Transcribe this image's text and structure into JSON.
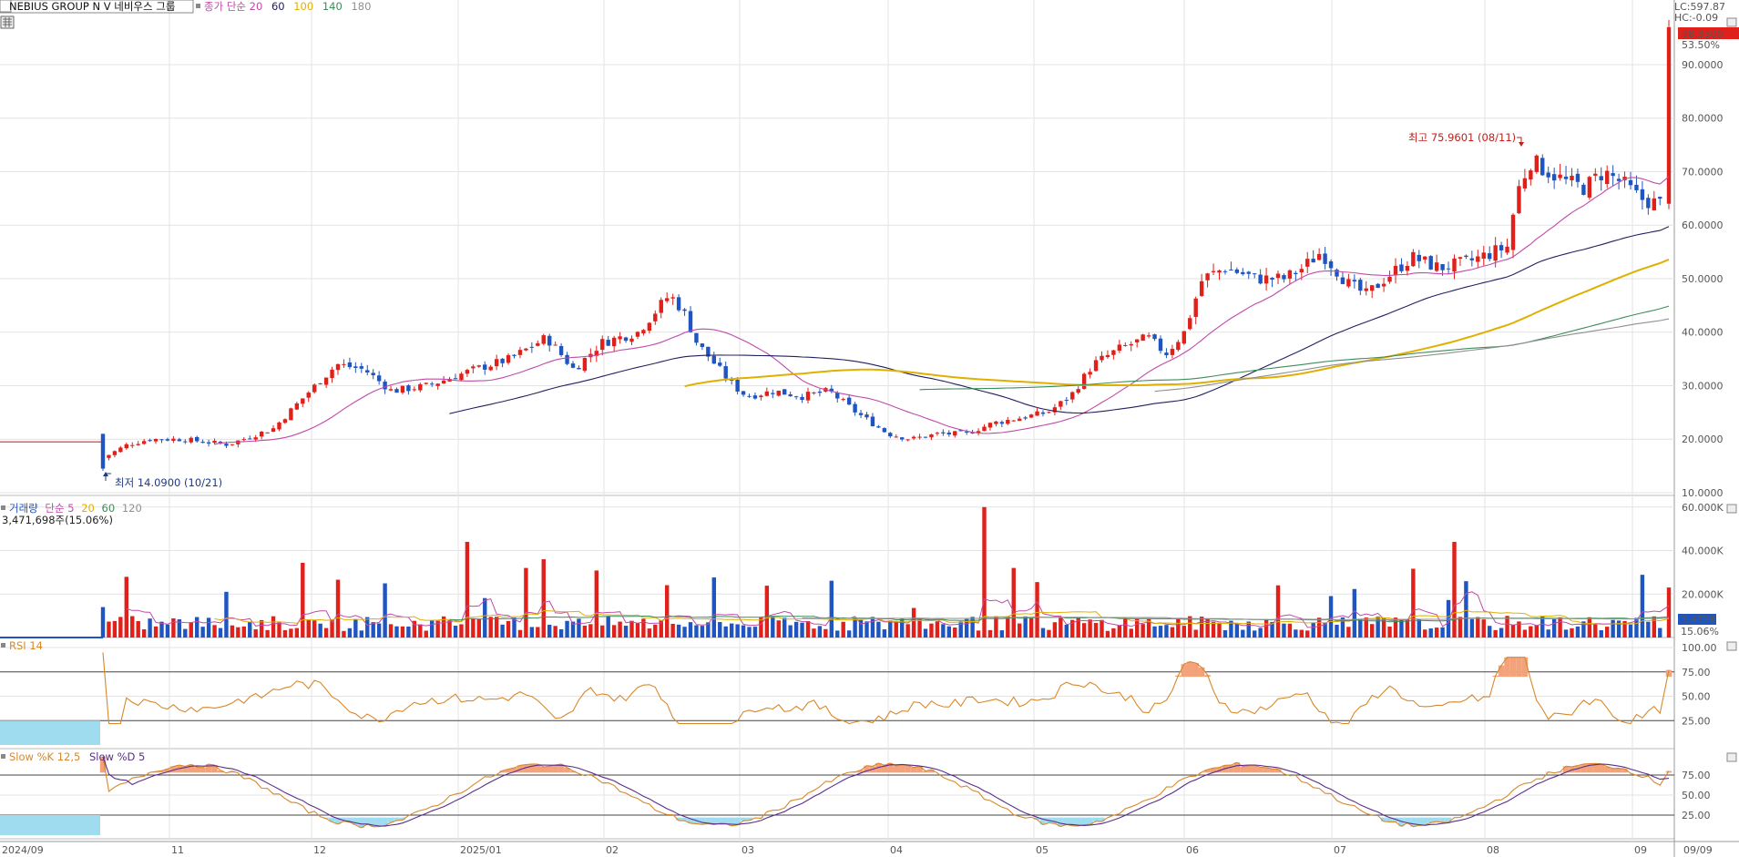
{
  "header": {
    "symbol": "NEBIUS GROUP N V",
    "name_kr": "네비우스 그룹",
    "ma_label": "종가 단순",
    "ma_periods": [
      "20",
      "60",
      "100",
      "140",
      "180"
    ],
    "lc_label": "LC:597.87",
    "hc_label": "HC:-0.09",
    "last_price": "98.3300",
    "last_change": "53.50%"
  },
  "annotations": {
    "high": "최고 75.9601 (08/11)",
    "low": "최저 14.0900 (10/21)"
  },
  "price_axis": [
    "90.0000",
    "80.0000",
    "70.0000",
    "60.0000",
    "50.0000",
    "40.0000",
    "30.0000",
    "20.0000",
    "10.0000"
  ],
  "volume": {
    "title": "거래량",
    "ma_label": "단순",
    "ma_periods": [
      "5",
      "20",
      "60",
      "120"
    ],
    "info": "3,471,698주(15.06%)",
    "axis": [
      "60.000K",
      "40.000K",
      "20.000K"
    ],
    "last_label": "3,472K",
    "last_pct": "15.06%"
  },
  "rsi": {
    "title": "RSI 14",
    "axis": [
      "100.00",
      "75.00",
      "50.00",
      "25.00"
    ]
  },
  "stoch": {
    "title_k": "Slow %K 12,5",
    "title_d": "Slow %D 5",
    "axis": [
      "75.00",
      "50.00",
      "25.00"
    ]
  },
  "x_axis": [
    "2024/09",
    "11",
    "12",
    "2025/01",
    "02",
    "03",
    "04",
    "05",
    "06",
    "07",
    "08",
    "09",
    "09/09"
  ],
  "colors": {
    "up": "#e0201a",
    "down": "#1f55c0",
    "ma20": "#c04aa8",
    "ma60": "#202060",
    "ma100": "#e0b000",
    "ma140": "#3d8c5a",
    "ma180": "#909090",
    "rsi": "#d8882a",
    "stoch_k": "#d8882a",
    "stoch_d": "#5a2d8c",
    "fill_hi": "#f3a27a",
    "fill_lo": "#9fdcf0"
  },
  "chart_data": {
    "type": "candlestick",
    "period": "daily",
    "x_range": [
      "2024/09",
      "09/09"
    ],
    "price_range": [
      10,
      98.33
    ],
    "price_anchors": [
      {
        "month": "2024/10 (10/21)",
        "price": 14.09,
        "note": "low"
      },
      {
        "month": "11",
        "price": 20
      },
      {
        "month": "12",
        "price": 34
      },
      {
        "month": "2025/01",
        "price": 31
      },
      {
        "month": "02",
        "price": 42
      },
      {
        "month": "03",
        "price": 32
      },
      {
        "month": "04",
        "price": 21
      },
      {
        "month": "05",
        "price": 30
      },
      {
        "month": "06",
        "price": 50
      },
      {
        "month": "07",
        "price": 48
      },
      {
        "month": "08 (08/11)",
        "price": 75.96,
        "note": "high"
      },
      {
        "month": "09/09",
        "price": 98.33,
        "note": "last"
      }
    ],
    "indicators": [
      "MA20",
      "MA60",
      "MA100",
      "MA140",
      "MA180",
      "Volume",
      "RSI 14",
      "Slow Stochastic 12,5,5"
    ],
    "rsi_levels": [
      25,
      50,
      75,
      100
    ],
    "stoch_levels": [
      25,
      50,
      75
    ]
  }
}
